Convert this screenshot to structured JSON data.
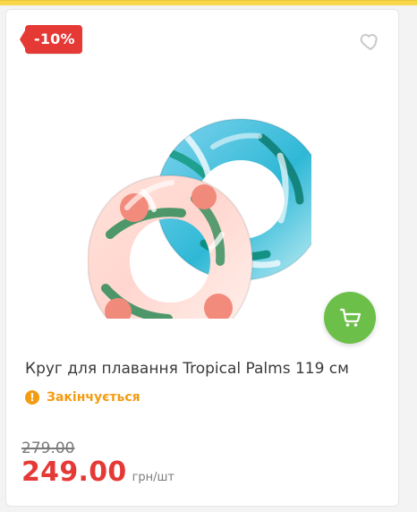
{
  "badge": {
    "discount": "-10%"
  },
  "icons": {
    "wishlist": "heart-outline-icon",
    "cart": "cart-icon",
    "status": "exclamation-circle-icon"
  },
  "product": {
    "title": "Круг для плавання Tropical Palms 119 см",
    "status": "Закінчується",
    "old_price": "279.00",
    "price": "249.00",
    "unit": "грн/шт"
  },
  "colors": {
    "accent_top": "#f7d64a",
    "badge_red": "#e53935",
    "cart_green": "#6cc04a",
    "status_orange": "#f39c12",
    "text_primary": "#3a3a3a",
    "muted": "#7c7c7c"
  }
}
